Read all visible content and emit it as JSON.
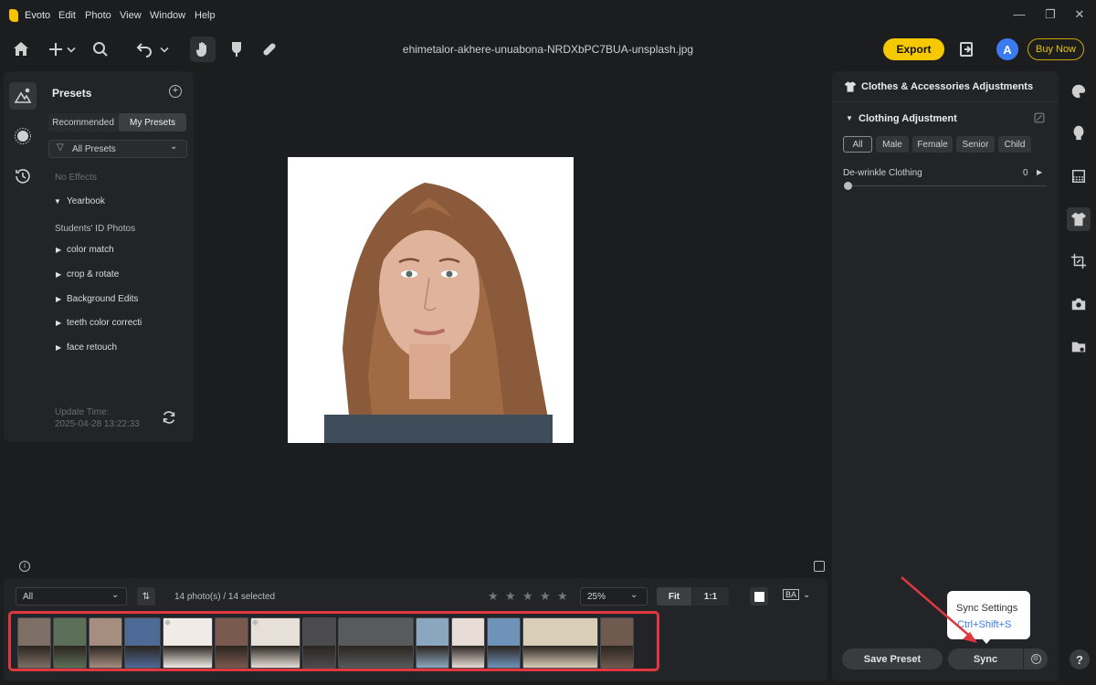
{
  "app": {
    "name": "Evoto"
  },
  "menu": [
    "Edit",
    "Photo",
    "View",
    "Window",
    "Help"
  ],
  "window_controls": [
    "—",
    "❐",
    "✕"
  ],
  "toolbar": {
    "file_name": "ehimetalor-akhere-unuabona-NRDXbPC7BUA-unsplash.jpg",
    "export_label": "Export",
    "avatar_initial": "A",
    "buy_now_label": "Buy Now"
  },
  "presets": {
    "title": "Presets",
    "add_symbol": "+",
    "tabs": [
      "Recommended",
      "My Presets"
    ],
    "active_tab": "My Presets",
    "filter_label": "All Presets",
    "no_effects": "No Effects",
    "group_label": "Yearbook",
    "subgroup_label": "Students' ID Photos",
    "items": [
      "color match",
      "crop & rotate",
      "Background Edits",
      "teeth color correcti",
      "face retouch"
    ],
    "update_label": "Update Time:",
    "update_time": "2025-04-28 13:22:33"
  },
  "right_panel": {
    "title": "Clothes & Accessories Adjustments",
    "section_title": "Clothing Adjustment",
    "chips": [
      "All",
      "Male",
      "Female",
      "Senior",
      "Child"
    ],
    "active_chip": "All",
    "slider": {
      "label": "De-wrinkle Clothing",
      "value": 0,
      "min": 0,
      "max": 100
    },
    "save_preset_label": "Save Preset",
    "sync_label": "Sync",
    "tooltip": {
      "title": "Sync Settings",
      "shortcut": "Ctrl+Shift+S"
    }
  },
  "bottom": {
    "filter_value": "All",
    "photo_count": "14 photo(s) / 14 selected",
    "rating_stars": 5,
    "zoom_value": "25%",
    "fit_label": "Fit",
    "one_to_one_label": "1:1",
    "ba_label": "BA",
    "help_label": "?",
    "info_symbol": "i"
  },
  "colors": {
    "accent": "#f5c800",
    "highlight_box": "#e0383e",
    "link_blue": "#3a7cf0",
    "panel_bg": "#232427",
    "app_bg": "#1c1d1f"
  },
  "icons": {
    "toolbar": [
      "home-icon",
      "add-icon",
      "chevron-down-icon",
      "search-icon",
      "undo-icon",
      "hand-icon",
      "brush-icon",
      "bandage-icon",
      "share-icon"
    ],
    "left_rail": [
      "presets-icon",
      "effects-icon",
      "history-icon"
    ],
    "right_rail": [
      "palette-icon",
      "face-icon",
      "background-icon",
      "clothes-icon",
      "crop-icon",
      "camera-icon",
      "folder-icon"
    ]
  },
  "filmstrip": {
    "count": 14,
    "colors": [
      "#7d6f65",
      "#5b6f58",
      "#a58e7f",
      "#4e6a96",
      "#f0ebe6",
      "#7a5a4e",
      "#e7e0d8",
      "#4b4b4e",
      "#585a5c",
      "#8aa7bf",
      "#e8ddd6",
      "#6e92b8",
      "#d9cfb9",
      "#6f5a4f"
    ]
  }
}
